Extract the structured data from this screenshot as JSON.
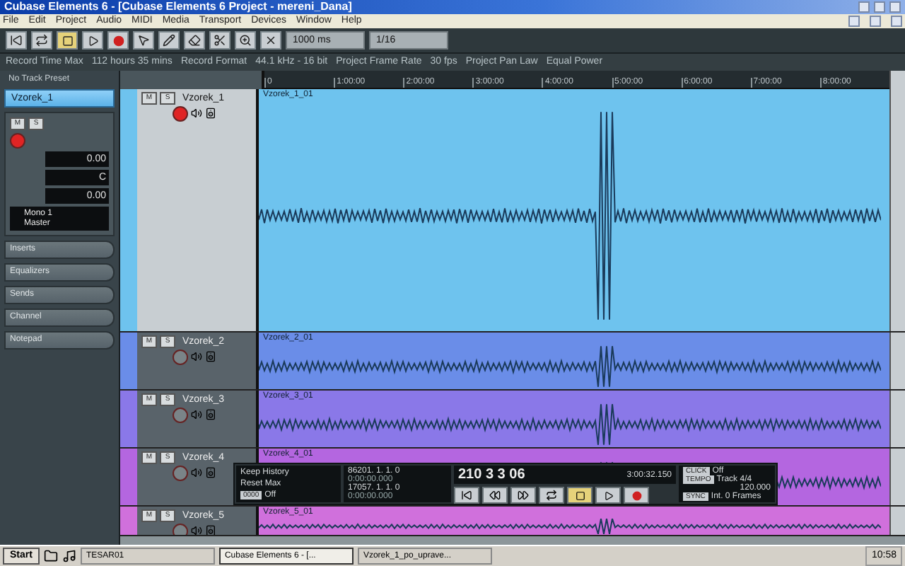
{
  "window": {
    "title": "Cubase Elements 6 - [Cubase Elements 6 Project - mereni_Dana]"
  },
  "menu": [
    "File",
    "Edit",
    "Project",
    "Audio",
    "MIDI",
    "Media",
    "Transport",
    "Devices",
    "Window",
    "Help"
  ],
  "toolbar": {
    "nudge": "1000 ms",
    "quantize": "1/16"
  },
  "info_line": [
    {
      "label": "Record Time Max",
      "value": "112 hours 35 mins"
    },
    {
      "label": "Record Format",
      "value": "44.1 kHz - 16 bit"
    },
    {
      "label": "Project Frame Rate",
      "value": "30 fps"
    },
    {
      "label": "Project Pan Law",
      "value": "Equal Power"
    }
  ],
  "inspector": {
    "preset": "No Track Preset",
    "track_name": "Vzorek_1",
    "volume": "0.00",
    "pan": "C",
    "delay": "0.00",
    "input": "Mono 1",
    "output": "Master",
    "sections": [
      "Inserts",
      "Equalizers",
      "Sends",
      "Channel",
      "Notepad"
    ]
  },
  "inspector_buttons": [
    "M",
    "S"
  ],
  "ruler": [
    "0",
    "1:00:00",
    "2:00:00",
    "3:00:00",
    "4:00:00",
    "5:00:00",
    "6:00:00",
    "7:00:00",
    "8:00:00"
  ],
  "tracks": [
    {
      "name": "Vzorek_1",
      "buttons": [
        "M",
        "S"
      ],
      "event": "Vzorek_1_01",
      "selected": true,
      "expanded": true,
      "armed": true,
      "color": "#6ec3ee"
    },
    {
      "name": "Vzorek_2",
      "buttons": [
        "M",
        "S"
      ],
      "event": "Vzorek_2_01",
      "selected": false,
      "expanded": false,
      "armed": false,
      "color": "#6a8de8"
    },
    {
      "name": "Vzorek_3",
      "buttons": [
        "M",
        "S"
      ],
      "event": "Vzorek_3_01",
      "selected": false,
      "expanded": false,
      "armed": false,
      "color": "#8a78e8"
    },
    {
      "name": "Vzorek_4",
      "buttons": [
        "M",
        "S"
      ],
      "event": "Vzorek_4_01",
      "selected": false,
      "expanded": false,
      "armed": false,
      "color": "#b466e0"
    },
    {
      "name": "Vzorek_5",
      "buttons": [
        "M",
        "S"
      ],
      "event": "Vzorek_5_01",
      "selected": false,
      "expanded": false,
      "armed": false,
      "color": "#d070dc"
    }
  ],
  "transport": {
    "history": "Keep History",
    "reset": "Reset Max",
    "counter": "0000",
    "off": "Off",
    "left_locator": "86201. 1. 1. 0",
    "left_time": "0:00:00.000",
    "right_locator": "17057. 1. 1. 0",
    "right_time": "0:00:00.000",
    "position": "210  3  3  06",
    "time": "3:00:32.150",
    "click": "CLICK",
    "click_value": "Off",
    "tempo": "TEMPO",
    "tempo_value": "Track  4/4",
    "bpm": "120.000",
    "sync": "SYNC",
    "sync_value": "Int.  0 Frames"
  },
  "taskbar": {
    "start": "Start",
    "items": [
      {
        "label": "TESAR01",
        "selected": false
      },
      {
        "label": "Cubase Elements 6 - [...",
        "selected": true
      },
      {
        "label": "Vzorek_1_po_uprave...",
        "selected": false
      }
    ],
    "clock": "10:58"
  }
}
